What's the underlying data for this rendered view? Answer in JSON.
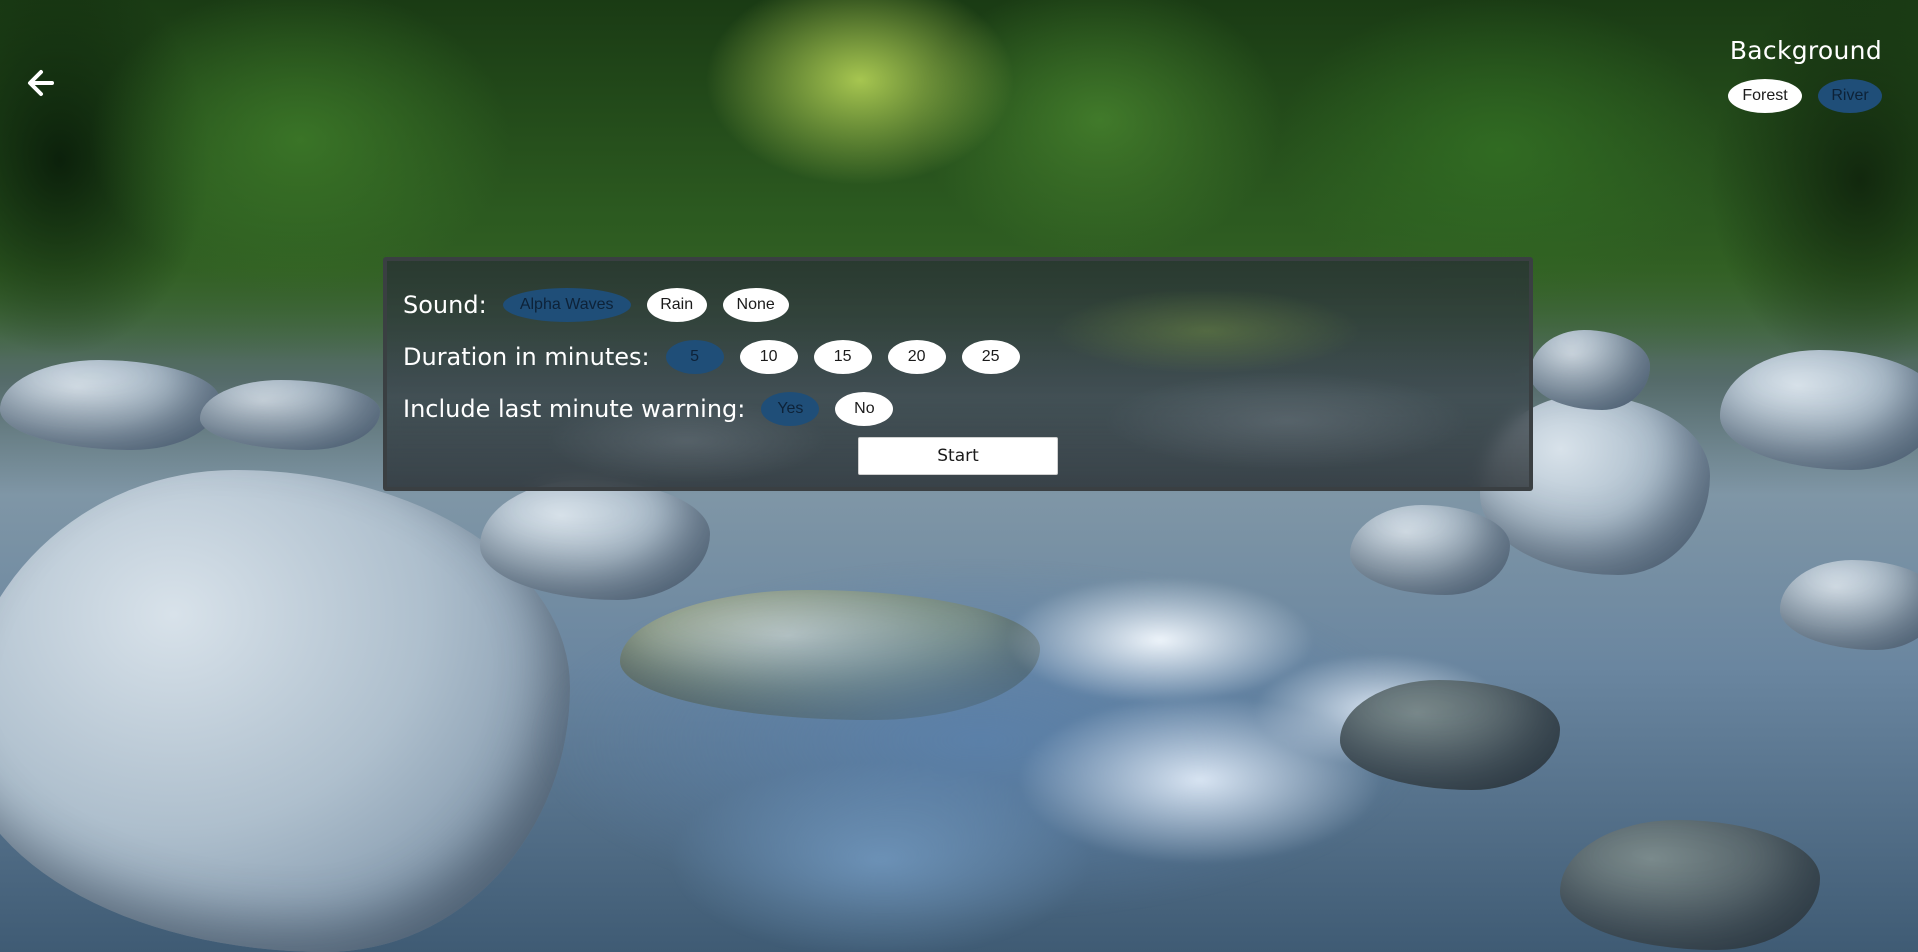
{
  "header": {
    "back_icon": "arrow-left-icon"
  },
  "background_selector": {
    "title": "Background",
    "options": [
      {
        "label": "Forest",
        "selected": false
      },
      {
        "label": "River",
        "selected": true
      }
    ]
  },
  "settings": {
    "sound": {
      "label": "Sound:",
      "options": [
        {
          "label": "Alpha Waves",
          "selected": true
        },
        {
          "label": "Rain",
          "selected": false
        },
        {
          "label": "None",
          "selected": false
        }
      ]
    },
    "duration": {
      "label": "Duration in minutes:",
      "options": [
        {
          "label": "5",
          "selected": true
        },
        {
          "label": "10",
          "selected": false
        },
        {
          "label": "15",
          "selected": false
        },
        {
          "label": "20",
          "selected": false
        },
        {
          "label": "25",
          "selected": false
        }
      ]
    },
    "warning": {
      "label": "Include last minute warning:",
      "options": [
        {
          "label": "Yes",
          "selected": true
        },
        {
          "label": "No",
          "selected": false
        }
      ]
    },
    "start_label": "Start"
  },
  "colors": {
    "selected_pill": "#1f4e78",
    "pill": "#ffffff",
    "panel_border": "#3a3f42"
  }
}
